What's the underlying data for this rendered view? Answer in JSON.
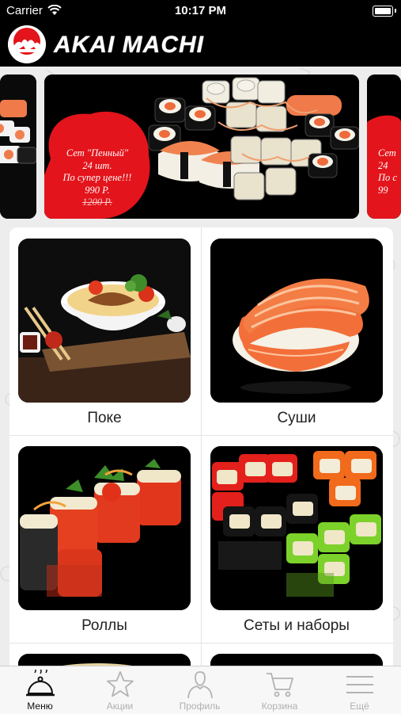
{
  "status_bar": {
    "carrier": "Carrier",
    "time": "10:17 PM"
  },
  "header": {
    "title": "AKAI MACHI"
  },
  "banner": {
    "main_promo_lines": [
      "Сет \"Пенный\"",
      "24 шт.",
      "По супер цене!!!",
      "990 Р."
    ],
    "main_old_price": "1200 Р.",
    "right_promo_lines": [
      "Сет",
      "24",
      "По с",
      "99"
    ]
  },
  "categories": [
    {
      "label": "Поке"
    },
    {
      "label": "Суши"
    },
    {
      "label": "Роллы"
    },
    {
      "label": "Сеты и наборы"
    }
  ],
  "tabbar": {
    "items": [
      {
        "label": "Меню",
        "icon": "cloche-icon",
        "active": true
      },
      {
        "label": "Акции",
        "icon": "star-icon",
        "active": false
      },
      {
        "label": "Профиль",
        "icon": "person-icon",
        "active": false
      },
      {
        "label": "Корзина",
        "icon": "cart-icon",
        "active": false
      },
      {
        "label": "Ещё",
        "icon": "menu-icon",
        "active": false
      }
    ]
  },
  "colors": {
    "accent_red": "#e3141b",
    "header_bg": "#000000",
    "content_bg": "#ededed"
  }
}
